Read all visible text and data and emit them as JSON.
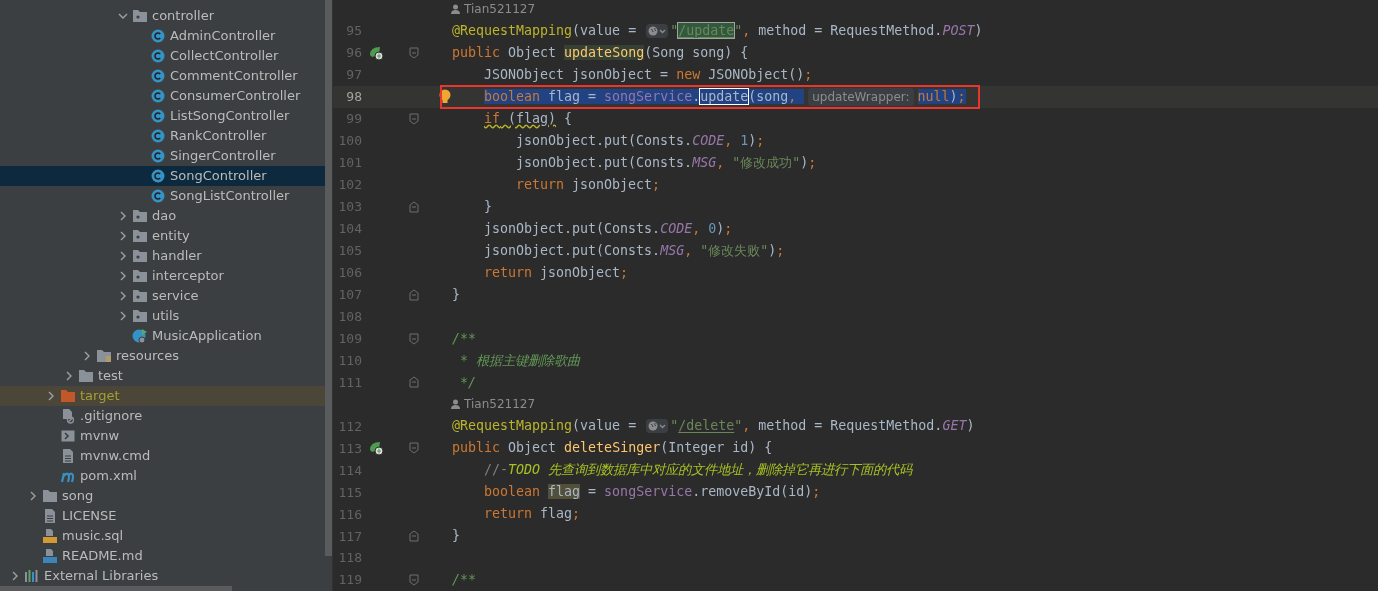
{
  "project_tree": [
    {
      "children": [
        {
          "children": [
            {
              "children": [
                {
                  "children": [
                    {
                      "children": [
                        {
                          "children": [
                            {
                              "label": "controller",
                              "kind": "package",
                              "expanded": true,
                              "selected": false,
                              "children": [
                                {
                                  "label": "AdminController",
                                  "kind": "class",
                                  "selected": false
                                },
                                {
                                  "label": "CollectController",
                                  "kind": "class",
                                  "selected": false
                                },
                                {
                                  "label": "CommentController",
                                  "kind": "class",
                                  "selected": false
                                },
                                {
                                  "label": "ConsumerController",
                                  "kind": "class",
                                  "selected": false
                                },
                                {
                                  "label": "ListSongController",
                                  "kind": "class",
                                  "selected": false
                                },
                                {
                                  "label": "RankController",
                                  "kind": "class",
                                  "selected": false
                                },
                                {
                                  "label": "SingerController",
                                  "kind": "class",
                                  "selected": false
                                },
                                {
                                  "label": "SongController",
                                  "kind": "class",
                                  "selected": true
                                },
                                {
                                  "label": "SongListController",
                                  "kind": "class",
                                  "selected": false
                                }
                              ]
                            },
                            {
                              "label": "dao",
                              "kind": "package",
                              "expanded": false,
                              "selected": false
                            },
                            {
                              "label": "entity",
                              "kind": "package",
                              "expanded": false,
                              "selected": false
                            },
                            {
                              "label": "handler",
                              "kind": "package",
                              "expanded": false,
                              "selected": false
                            },
                            {
                              "label": "interceptor",
                              "kind": "package",
                              "expanded": false,
                              "selected": false
                            },
                            {
                              "label": "service",
                              "kind": "package",
                              "expanded": false,
                              "selected": false
                            },
                            {
                              "label": "utils",
                              "kind": "package",
                              "expanded": false,
                              "selected": false
                            },
                            {
                              "label": "MusicApplication",
                              "kind": "app",
                              "selected": false
                            }
                          ]
                        }
                      ]
                    },
                    {
                      "label": "resources",
                      "kind": "resources",
                      "expanded": false,
                      "selected": false
                    }
                  ]
                },
                {
                  "label": "test",
                  "kind": "folder",
                  "expanded": false,
                  "selected": false
                }
              ]
            },
            {
              "label": "target",
              "kind": "excluded",
              "expanded": false,
              "selected": false
            },
            {
              "label": ".gitignore",
              "kind": "ignore",
              "selected": false
            },
            {
              "label": "mvnw",
              "kind": "shell",
              "selected": false
            },
            {
              "label": "mvnw.cmd",
              "kind": "text",
              "selected": false
            },
            {
              "label": "pom.xml",
              "kind": "maven",
              "selected": false
            }
          ]
        },
        {
          "label": "song",
          "kind": "folder",
          "expanded": false,
          "selected": false
        },
        {
          "label": "LICENSE",
          "kind": "text",
          "selected": false
        },
        {
          "label": "music.sql",
          "kind": "sql",
          "selected": false
        },
        {
          "label": "README.md",
          "kind": "md",
          "selected": false
        }
      ]
    },
    {
      "label": "External Libraries",
      "kind": "libraries",
      "expanded": false,
      "selected": false
    }
  ],
  "editor": {
    "lines": [
      {
        "kind": "author",
        "text": "Tian521127"
      },
      {
        "kind": "code",
        "number": "95",
        "selected": false,
        "boxed": false,
        "tokens": [
          {
            "kind": "annotation",
            "text": "@RequestMapping"
          },
          {
            "kind": "plain",
            "text": "(value = "
          },
          {
            "kind": "link-icon"
          },
          {
            "kind": "string",
            "text": "\""
          },
          {
            "kind": "url",
            "text": "/update",
            "highlight": {
              "kind": "match"
            }
          },
          {
            "kind": "string",
            "text": "\""
          },
          {
            "kind": "punct",
            "text": ", "
          },
          {
            "kind": "plain",
            "text": "method = RequestMethod."
          },
          {
            "kind": "constant",
            "text": "POST"
          },
          {
            "kind": "plain",
            "text": ")"
          }
        ]
      },
      {
        "kind": "code",
        "number": "96",
        "gutter_icon": {
          "kind": "endpoint"
        },
        "fold_marker": {
          "kind": "start"
        },
        "selected": false,
        "boxed": false,
        "tokens": [
          {
            "kind": "keyword",
            "text": "public"
          },
          {
            "kind": "plain",
            "text": " Object "
          },
          {
            "kind": "method",
            "text": "updateSong",
            "highlight": {
              "kind": "usage"
            }
          },
          {
            "kind": "plain",
            "text": "(Song song) {"
          }
        ],
        "children": [
          {
            "kind": "code",
            "number": "97",
            "selected": false,
            "boxed": false,
            "tokens": [
              {
                "kind": "plain",
                "text": "JSONObject jsonObject = "
              },
              {
                "kind": "keyword",
                "text": "new"
              },
              {
                "kind": "plain",
                "text": " JSONObject()"
              },
              {
                "kind": "punct",
                "text": ";"
              }
            ]
          },
          {
            "kind": "code",
            "number": "98",
            "gutter_icon": {
              "kind": "bulb"
            },
            "selected": true,
            "boxed": true,
            "tokens": [
              {
                "kind": "keyword",
                "text": "boolean"
              },
              {
                "kind": "plain",
                "text": " flag = "
              },
              {
                "kind": "member",
                "text": "songService"
              },
              {
                "kind": "plain",
                "text": "."
              },
              {
                "kind": "plain",
                "text": "update",
                "highlight": {
                  "kind": "caret"
                }
              },
              {
                "kind": "plain",
                "text": "(song"
              },
              {
                "kind": "punct",
                "text": ", "
              },
              {
                "kind": "hint",
                "text": "updateWrapper:"
              },
              {
                "kind": "keyword",
                "text": "null"
              },
              {
                "kind": "plain",
                "text": ")"
              },
              {
                "kind": "punct",
                "text": ";"
              }
            ]
          },
          {
            "kind": "code",
            "number": "99",
            "fold_marker": {
              "kind": "start"
            },
            "selected": false,
            "boxed": false,
            "tokens": [
              {
                "kind": "keyword",
                "text": "if",
                "highlight": {
                  "kind": "warning"
                }
              },
              {
                "kind": "plain",
                "text": " (flag)",
                "highlight": {
                  "kind": "warning"
                }
              },
              {
                "kind": "plain",
                "text": " {"
              }
            ],
            "children": [
              {
                "kind": "code",
                "number": "100",
                "selected": false,
                "boxed": false,
                "tokens": [
                  {
                    "kind": "plain",
                    "text": "jsonObject.put(Consts."
                  },
                  {
                    "kind": "constant",
                    "text": "CODE"
                  },
                  {
                    "kind": "punct",
                    "text": ", "
                  },
                  {
                    "kind": "number",
                    "text": "1"
                  },
                  {
                    "kind": "plain",
                    "text": ")"
                  },
                  {
                    "kind": "punct",
                    "text": ";"
                  }
                ]
              },
              {
                "kind": "code",
                "number": "101",
                "selected": false,
                "boxed": false,
                "tokens": [
                  {
                    "kind": "plain",
                    "text": "jsonObject.put(Consts."
                  },
                  {
                    "kind": "constant",
                    "text": "MSG"
                  },
                  {
                    "kind": "punct",
                    "text": ", "
                  },
                  {
                    "kind": "string",
                    "text": "\"修改成功\""
                  },
                  {
                    "kind": "plain",
                    "text": ")"
                  },
                  {
                    "kind": "punct",
                    "text": ";"
                  }
                ]
              },
              {
                "kind": "code",
                "number": "102",
                "selected": false,
                "boxed": false,
                "tokens": [
                  {
                    "kind": "keyword",
                    "text": "return"
                  },
                  {
                    "kind": "plain",
                    "text": " jsonObject"
                  },
                  {
                    "kind": "punct",
                    "text": ";"
                  }
                ]
              }
            ]
          },
          {
            "kind": "code",
            "number": "103",
            "fold_marker": {
              "kind": "end"
            },
            "selected": false,
            "boxed": false,
            "tokens": [
              {
                "kind": "plain",
                "text": "}"
              }
            ]
          },
          {
            "kind": "code",
            "number": "104",
            "selected": false,
            "boxed": false,
            "tokens": [
              {
                "kind": "plain",
                "text": "jsonObject.put(Consts."
              },
              {
                "kind": "constant",
                "text": "CODE"
              },
              {
                "kind": "punct",
                "text": ", "
              },
              {
                "kind": "number",
                "text": "0"
              },
              {
                "kind": "plain",
                "text": ")"
              },
              {
                "kind": "punct",
                "text": ";"
              }
            ]
          },
          {
            "kind": "code",
            "number": "105",
            "selected": false,
            "boxed": false,
            "tokens": [
              {
                "kind": "plain",
                "text": "jsonObject.put(Consts."
              },
              {
                "kind": "constant",
                "text": "MSG"
              },
              {
                "kind": "punct",
                "text": ", "
              },
              {
                "kind": "string",
                "text": "\"修改失败\""
              },
              {
                "kind": "plain",
                "text": ")"
              },
              {
                "kind": "punct",
                "text": ";"
              }
            ]
          },
          {
            "kind": "code",
            "number": "106",
            "selected": false,
            "boxed": false,
            "tokens": [
              {
                "kind": "keyword",
                "text": "return"
              },
              {
                "kind": "plain",
                "text": " jsonObject"
              },
              {
                "kind": "punct",
                "text": ";"
              }
            ]
          }
        ]
      },
      {
        "kind": "code",
        "number": "107",
        "fold_marker": {
          "kind": "end"
        },
        "selected": false,
        "boxed": false,
        "tokens": [
          {
            "kind": "plain",
            "text": "}"
          }
        ]
      },
      {
        "kind": "code",
        "number": "108",
        "selected": false,
        "boxed": false
      },
      {
        "kind": "code",
        "number": "109",
        "fold_marker": {
          "kind": "start"
        },
        "selected": false,
        "boxed": false,
        "tokens": [
          {
            "kind": "doc",
            "text": "/**"
          }
        ]
      },
      {
        "kind": "code",
        "number": "110",
        "selected": false,
        "boxed": false,
        "tokens": [
          {
            "kind": "doc",
            "text": " * 根据主键删除歌曲"
          }
        ]
      },
      {
        "kind": "code",
        "number": "111",
        "fold_marker": {
          "kind": "end"
        },
        "selected": false,
        "boxed": false,
        "tokens": [
          {
            "kind": "doc",
            "text": " */"
          }
        ]
      },
      {
        "kind": "author",
        "text": "Tian521127"
      },
      {
        "kind": "code",
        "number": "112",
        "selected": false,
        "boxed": false,
        "tokens": [
          {
            "kind": "annotation",
            "text": "@RequestMapping"
          },
          {
            "kind": "plain",
            "text": "(value = "
          },
          {
            "kind": "link-icon"
          },
          {
            "kind": "string",
            "text": "\""
          },
          {
            "kind": "url",
            "text": "/delete"
          },
          {
            "kind": "string",
            "text": "\""
          },
          {
            "kind": "punct",
            "text": ", "
          },
          {
            "kind": "plain",
            "text": "method = RequestMethod."
          },
          {
            "kind": "constant",
            "text": "GET"
          },
          {
            "kind": "plain",
            "text": ")"
          }
        ]
      },
      {
        "kind": "code",
        "number": "113",
        "gutter_icon": {
          "kind": "endpoint"
        },
        "fold_marker": {
          "kind": "start"
        },
        "selected": false,
        "boxed": false,
        "tokens": [
          {
            "kind": "keyword",
            "text": "public"
          },
          {
            "kind": "plain",
            "text": " Object "
          },
          {
            "kind": "method",
            "text": "deleteSinger"
          },
          {
            "kind": "plain",
            "text": "(Integer id) {"
          }
        ],
        "children": [
          {
            "kind": "code",
            "number": "114",
            "selected": false,
            "boxed": false,
            "tokens": [
              {
                "kind": "comment",
                "text": "//-"
              },
              {
                "kind": "todo",
                "text": "TODO 先查询到数据库中对应的文件地址，删除掉它再进行下面的代码"
              }
            ]
          },
          {
            "kind": "code",
            "number": "115",
            "selected": false,
            "boxed": false,
            "tokens": [
              {
                "kind": "keyword",
                "text": "boolean "
              },
              {
                "kind": "plain",
                "text": "flag",
                "highlight": {
                  "kind": "read"
                }
              },
              {
                "kind": "plain",
                "text": " = "
              },
              {
                "kind": "member",
                "text": "songService"
              },
              {
                "kind": "plain",
                "text": ".removeById(id)"
              },
              {
                "kind": "punct",
                "text": ";"
              }
            ]
          },
          {
            "kind": "code",
            "number": "116",
            "selected": false,
            "boxed": false,
            "tokens": [
              {
                "kind": "keyword",
                "text": "return"
              },
              {
                "kind": "plain",
                "text": " flag"
              },
              {
                "kind": "punct",
                "text": ";"
              }
            ]
          }
        ]
      },
      {
        "kind": "code",
        "number": "117",
        "fold_marker": {
          "kind": "end"
        },
        "selected": false,
        "boxed": false,
        "tokens": [
          {
            "kind": "plain",
            "text": "}"
          }
        ]
      },
      {
        "kind": "code",
        "number": "118",
        "selected": false,
        "boxed": false
      },
      {
        "kind": "code",
        "number": "119",
        "fold_marker": {
          "kind": "start"
        },
        "selected": false,
        "boxed": false,
        "tokens": [
          {
            "kind": "doc",
            "text": "/**"
          }
        ]
      }
    ]
  }
}
